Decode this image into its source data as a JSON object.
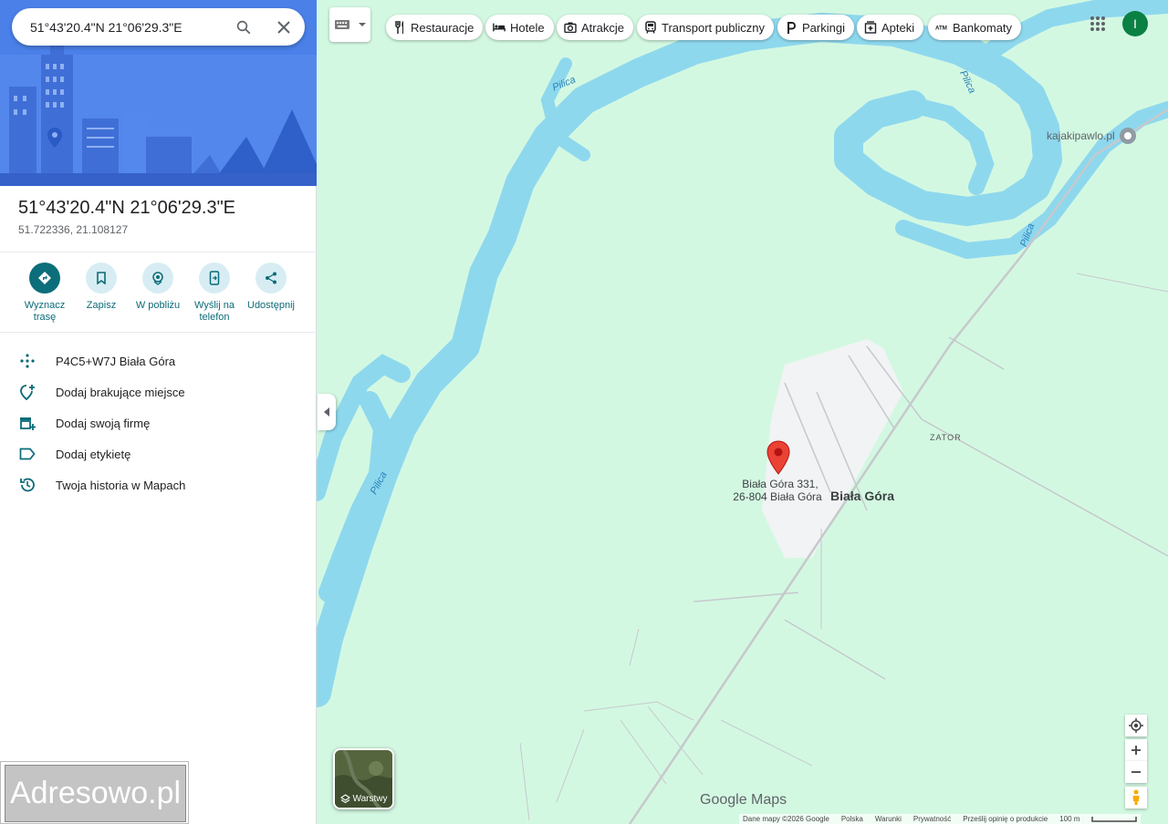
{
  "search": {
    "value": "51°43'20.4\"N 21°06'29.3\"E"
  },
  "place": {
    "title": "51°43'20.4\"N 21°06'29.3\"E",
    "coords": "51.722336, 21.108127"
  },
  "actions": [
    {
      "label": "Wyznacz trasę",
      "icon": "directions-icon"
    },
    {
      "label": "Zapisz",
      "icon": "bookmark-icon"
    },
    {
      "label": "W pobliżu",
      "icon": "nearby-icon"
    },
    {
      "label": "Wyślij na telefon",
      "icon": "send-to-phone-icon"
    },
    {
      "label": "Udostępnij",
      "icon": "share-icon"
    }
  ],
  "info_rows": [
    {
      "text": "P4C5+W7J Biała Góra",
      "icon": "plus-code-icon"
    },
    {
      "text": "Dodaj brakujące miejsce",
      "icon": "add-place-icon"
    },
    {
      "text": "Dodaj swoją firmę",
      "icon": "add-business-icon"
    },
    {
      "text": "Dodaj etykietę",
      "icon": "label-icon"
    },
    {
      "text": "Twoja historia w Mapach",
      "icon": "history-icon"
    }
  ],
  "watermark": "Adresowo.pl",
  "chips": [
    {
      "label": "Restauracje",
      "icon": "restaurant-icon"
    },
    {
      "label": "Hotele",
      "icon": "hotel-icon"
    },
    {
      "label": "Atrakcje",
      "icon": "camera-icon"
    },
    {
      "label": "Transport publiczny",
      "icon": "transit-icon"
    },
    {
      "label": "Parkingi",
      "icon": "parking-icon"
    },
    {
      "label": "Apteki",
      "icon": "pharmacy-icon"
    },
    {
      "label": "Bankomaty",
      "icon": "atm-icon"
    }
  ],
  "account_initial": "I",
  "map": {
    "river_label": "Pilica",
    "poi": "kajakipawlo.pl",
    "area_label": "ZATOR",
    "town_label": "Biała Góra",
    "pin_address_line1": "Biała Góra 331,",
    "pin_address_line2": "26-804 Biała Góra",
    "layers_label": "Warstwy",
    "logo": "Google Maps"
  },
  "footer": {
    "items": [
      "Dane mapy ©2026 Google",
      "Polska",
      "Warunki",
      "Prywatność",
      "Prześlij opinię o produkcie"
    ],
    "scale": "100 m"
  },
  "colors": {
    "water": "#8ed8ee",
    "land": "#d3f8e2",
    "accent": "#0b6e7a",
    "pin": "#ea4335"
  }
}
